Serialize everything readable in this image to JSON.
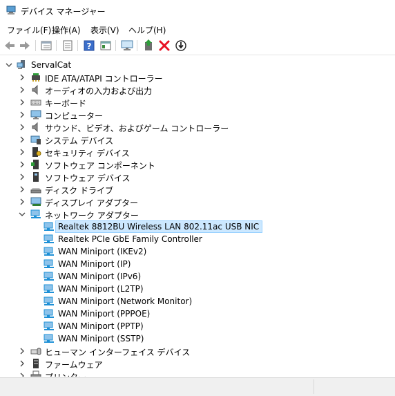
{
  "window": {
    "title": "デバイス マネージャー"
  },
  "menu": [
    {
      "label": "ファイル(F)"
    },
    {
      "label": "操作(A)"
    },
    {
      "label": "表示(V)"
    },
    {
      "label": "ヘルプ(H)"
    }
  ],
  "toolbar": {
    "icons": [
      "back-arrow-icon",
      "forward-arrow-icon",
      "properties-grid-icon",
      "device-list-icon",
      "help-icon",
      "view-panel-icon",
      "monitor-scan-icon",
      "update-driver-icon",
      "uninstall-x-icon",
      "disable-device-icon"
    ]
  },
  "tree": {
    "root": {
      "label": "ServalCat",
      "icon": "computer-icon"
    },
    "categories": [
      {
        "label": "IDE ATA/ATAPI コントローラー",
        "icon": "ide-controller-icon"
      },
      {
        "label": "オーディオの入力および出力",
        "icon": "speaker-icon"
      },
      {
        "label": "キーボード",
        "icon": "keyboard-icon"
      },
      {
        "label": "コンピューター",
        "icon": "monitor-icon"
      },
      {
        "label": "サウンド、ビデオ、およびゲーム コントローラー",
        "icon": "speaker-icon"
      },
      {
        "label": "システム デバイス",
        "icon": "system-device-icon"
      },
      {
        "label": "セキュリティ デバイス",
        "icon": "security-device-icon"
      },
      {
        "label": "ソフトウェア コンポーネント",
        "icon": "software-component-icon"
      },
      {
        "label": "ソフトウェア デバイス",
        "icon": "software-device-icon"
      },
      {
        "label": "ディスク ドライブ",
        "icon": "disk-drive-icon"
      },
      {
        "label": "ディスプレイ アダプター",
        "icon": "display-adapter-icon"
      },
      {
        "label": "ネットワーク アダプター",
        "icon": "network-adapter-icon",
        "expanded": true,
        "children": [
          {
            "label": "Realtek 8812BU Wireless LAN 802.11ac USB NIC",
            "selected": true
          },
          {
            "label": "Realtek PCIe GbE Family Controller"
          },
          {
            "label": "WAN Miniport (IKEv2)"
          },
          {
            "label": "WAN Miniport (IP)"
          },
          {
            "label": "WAN Miniport (IPv6)"
          },
          {
            "label": "WAN Miniport (L2TP)"
          },
          {
            "label": "WAN Miniport (Network Monitor)"
          },
          {
            "label": "WAN Miniport (PPPOE)"
          },
          {
            "label": "WAN Miniport (PPTP)"
          },
          {
            "label": "WAN Miniport (SSTP)"
          }
        ]
      },
      {
        "label": "ヒューマン インターフェイス デバイス",
        "icon": "hid-icon"
      },
      {
        "label": "ファームウェア",
        "icon": "firmware-icon"
      },
      {
        "label": "プリンター",
        "icon": "printer-icon"
      }
    ]
  },
  "colors": {
    "selection": "#cce8ff",
    "selection_border": "#99d1ff",
    "uninstall": "#e81123",
    "network": "#1e90d6"
  }
}
